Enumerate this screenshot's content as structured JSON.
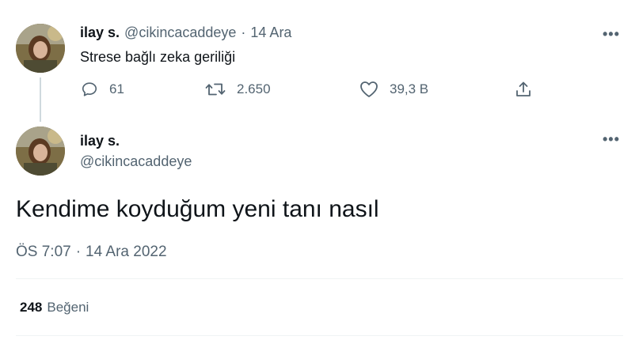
{
  "reply_tweet": {
    "name": "ilay s.",
    "handle": "@cikincacaddeye",
    "separator": "·",
    "date": "14 Ara",
    "text": "Strese bağlı zeka geriliği",
    "more": "•••",
    "actions": {
      "replies": "61",
      "retweets": "2.650",
      "likes": "39,3 B"
    }
  },
  "main_tweet": {
    "name": "ilay s.",
    "handle": "@cikincacaddeye",
    "more": "•••",
    "text": "Kendime koyduğum yeni tanı nasıl",
    "time": "ÖS 7:07",
    "separator": "·",
    "date": "14 Ara 2022",
    "likes_count": "248",
    "likes_label": "Beğeni"
  },
  "colors": {
    "text": "#0f1419",
    "secondary": "#536471",
    "divider": "#eff3f4",
    "thread_line": "#cfd9de"
  }
}
